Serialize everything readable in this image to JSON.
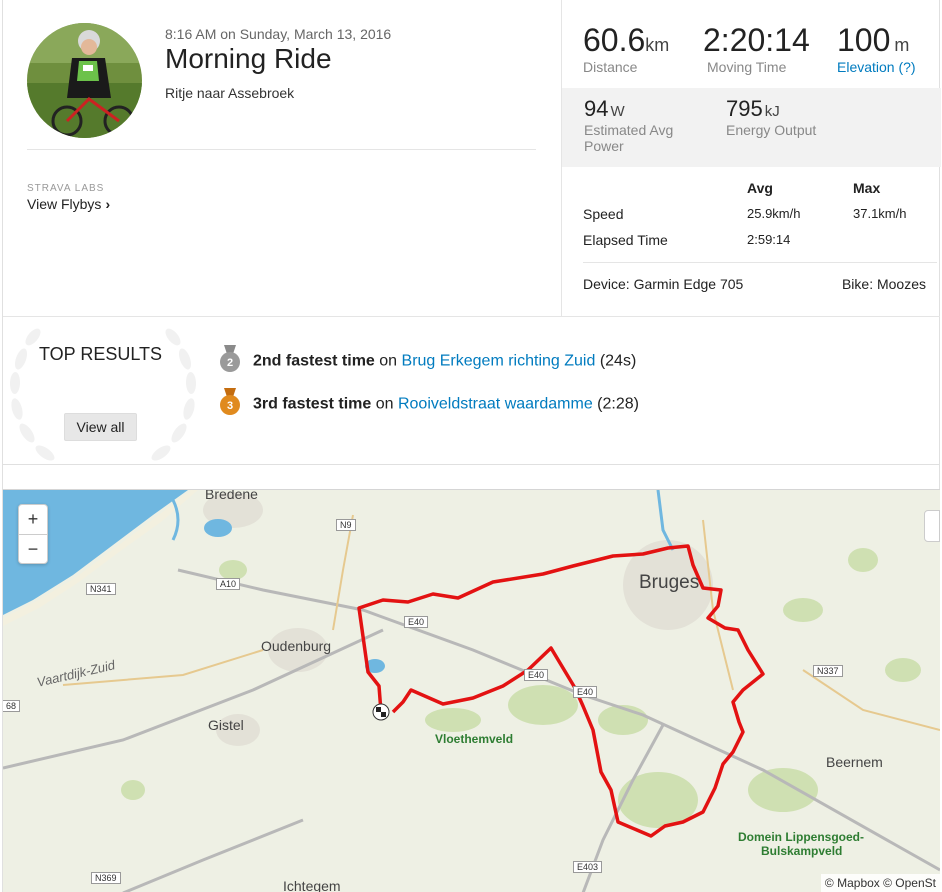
{
  "activity": {
    "datetime": "8:16 AM on Sunday, March 13, 2016",
    "title": "Morning Ride",
    "description": "Ritje naar Assebroek"
  },
  "labs": {
    "label": "STRAVA LABS",
    "link": "View Flybys"
  },
  "stats": {
    "distance": {
      "value": "60.6",
      "unit": "km",
      "label": "Distance"
    },
    "moving_time": {
      "value": "2:20:14",
      "label": "Moving Time"
    },
    "elevation": {
      "value": "100",
      "unit": "m",
      "label": "Elevation (?)"
    },
    "power": {
      "value": "94",
      "unit": "W",
      "label": "Estimated Avg Power"
    },
    "energy": {
      "value": "795",
      "unit": "kJ",
      "label": "Energy Output"
    },
    "table": {
      "head_avg": "Avg",
      "head_max": "Max",
      "speed_label": "Speed",
      "speed_avg": "25.9km/h",
      "speed_max": "37.1km/h",
      "elapsed_label": "Elapsed Time",
      "elapsed_avg": "2:59:14"
    },
    "device": "Device: Garmin Edge 705",
    "bike": "Bike: Moozes"
  },
  "top_results": {
    "label": "TOP RESULTS",
    "view_all": "View all",
    "achievements": [
      {
        "medal": "2",
        "rank": "2nd fastest time",
        "on": "on",
        "segment": "Brug Erkegem richting Zuid",
        "time": "(24s)",
        "color": "#9a9a9a"
      },
      {
        "medal": "3",
        "rank": "3rd fastest time",
        "on": "on",
        "segment": "Rooiveldstraat waardamme",
        "time": "(2:28)",
        "color": "#e08a1e"
      }
    ]
  },
  "map": {
    "zoom_in": "+",
    "zoom_out": "−",
    "attribution": "© Mapbox © OpenSt",
    "labels": {
      "bredene": "Bredene",
      "bruges": "Bruges",
      "oudenburg": "Oudenburg",
      "gistel": "Gistel",
      "vaartdijk": "Vaartdijk-Zuid",
      "vloethemveld": "Vloethemveld",
      "beernem": "Beernem",
      "domein1": "Domein Lippensgoed-",
      "domein2": "Bulskampveld",
      "ichtegem": "Ichtegem",
      "n9": "N9",
      "a10": "A10",
      "n341": "N341",
      "e40a": "E40",
      "e40b": "E40",
      "e40c": "E40",
      "n337": "N337",
      "e403": "E403",
      "n369": "N369",
      "n368": "68"
    },
    "route_color": "#e31212",
    "sea_color": "#6fb7e0"
  }
}
